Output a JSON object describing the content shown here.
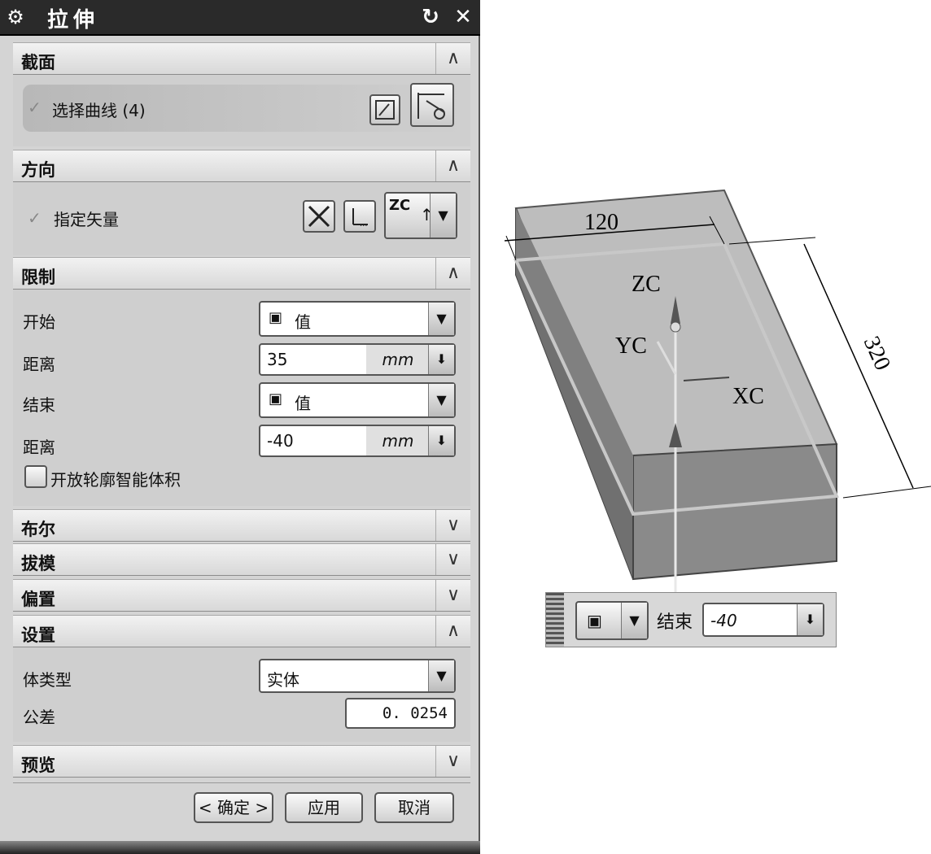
{
  "dialog": {
    "title": "拉伸",
    "icons": [
      "gear-icon",
      "reset-icon",
      "close-icon"
    ],
    "sections": {
      "section": {
        "label": "截面",
        "select_curve": "选择曲线 (4)"
      },
      "direction": {
        "label": "方向",
        "specify_vector": "指定矢量",
        "vector_value": "ZC"
      },
      "limits": {
        "label": "限制",
        "start_label": "开始",
        "start_value": "值",
        "start_distance_label": "距离",
        "start_distance": "35",
        "end_label": "结束",
        "end_value": "值",
        "end_distance_label": "距离",
        "end_distance": "-40",
        "unit": "mm",
        "open_profile_checkbox": "开放轮廓智能体积"
      },
      "boolean": {
        "label": "布尔"
      },
      "draft": {
        "label": "拔模"
      },
      "offset": {
        "label": "偏置"
      },
      "settings": {
        "label": "设置",
        "body_type_label": "体类型",
        "body_type_value": "实体",
        "tolerance_label": "公差",
        "tolerance_value": "0. 0254"
      },
      "preview": {
        "label": "预览"
      }
    },
    "buttons": {
      "ok": "< 确定 >",
      "apply": "应用",
      "cancel": "取消"
    }
  },
  "viewport": {
    "dimension_width": "120",
    "dimension_length": "320",
    "axis_z": "ZC",
    "axis_y": "YC",
    "axis_x": "XC",
    "handle_label": "结束",
    "handle_value": "-40"
  }
}
